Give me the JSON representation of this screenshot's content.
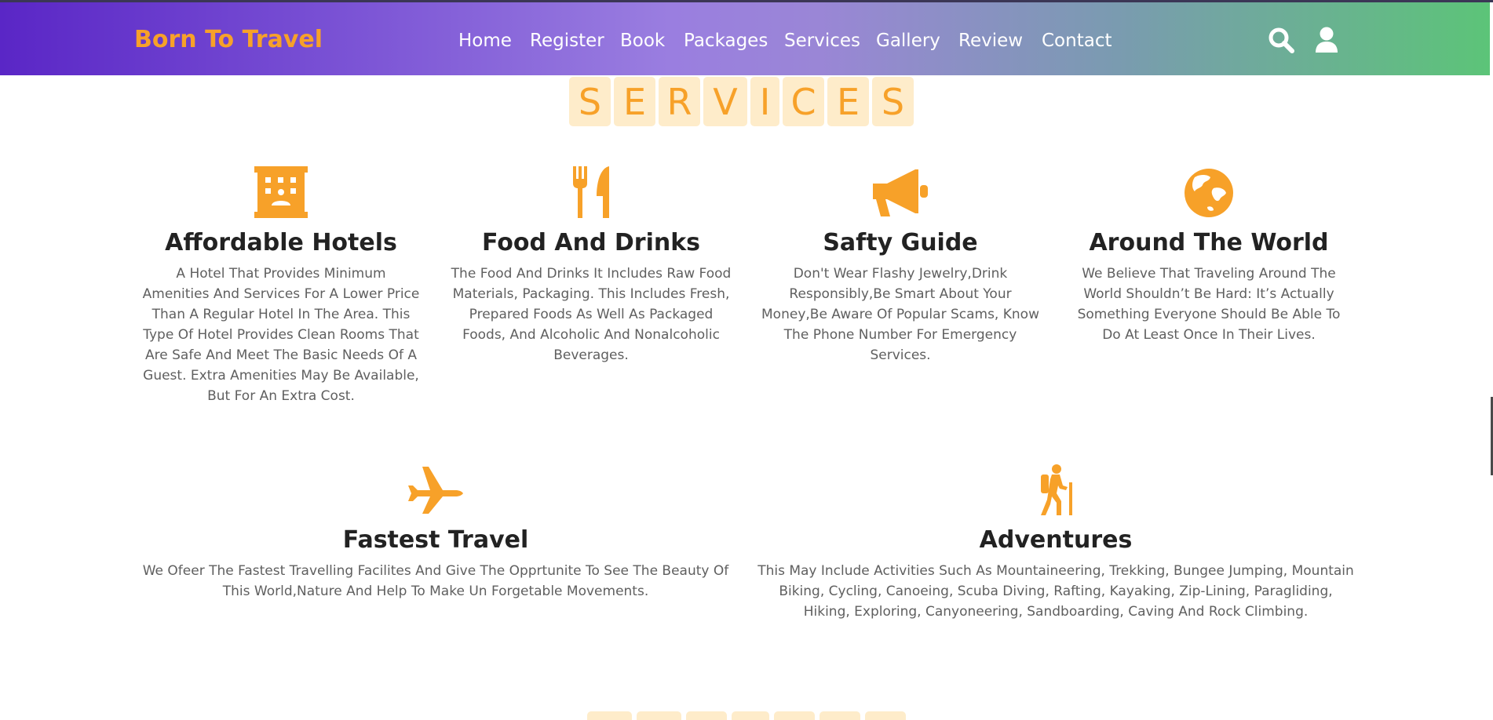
{
  "header": {
    "logo": "Born To Travel",
    "nav": [
      "Home",
      "Register",
      "Book",
      "Packages",
      "Services",
      "Gallery",
      "Review",
      "Contact"
    ],
    "icons": [
      "search-icon",
      "user-icon"
    ]
  },
  "section": {
    "title_letters": [
      "S",
      "E",
      "R",
      "V",
      "I",
      "C",
      "E",
      "S"
    ]
  },
  "services": [
    {
      "icon": "hotel-icon",
      "title": "Affordable Hotels",
      "text": "A Hotel That Provides Minimum Amenities And Services For A Lower Price Than A Regular Hotel In The Area. This Type Of Hotel Provides Clean Rooms That Are Safe And Meet The Basic Needs Of A Guest. Extra Amenities May Be Available, But For An Extra Cost."
    },
    {
      "icon": "utensils-icon",
      "title": "Food And Drinks",
      "text": "The Food And Drinks It Includes Raw Food Materials, Packaging. This Includes Fresh, Prepared Foods As Well As Packaged Foods, And Alcoholic And Nonalcoholic Beverages."
    },
    {
      "icon": "bullhorn-icon",
      "title": "Safty Guide",
      "text": "Don't Wear Flashy Jewelry,Drink Responsibly,Be Smart About Your Money,Be Aware Of Popular Scams, Know The Phone Number For Emergency Services."
    },
    {
      "icon": "globe-icon",
      "title": "Around The World",
      "text": "We Believe That Traveling Around The World Shouldn’t Be Hard: It’s Actually Something Everyone Should Be Able To Do At Least Once In Their Lives."
    },
    {
      "icon": "plane-icon",
      "title": "Fastest Travel",
      "text": "We Ofeer The Fastest Travelling Facilites And Give The Opprtunite To See The Beauty Of This World,Nature And Help To Make Un Forgetable Movements."
    },
    {
      "icon": "hiking-icon",
      "title": "Adventures",
      "text": "This May Include Activities Such As Mountaineering, Trekking, Bungee Jumping, Mountain Biking, Cycling, Canoeing, Scuba Diving, Rafting, Kayaking, Zip-Lining, Paragliding, Hiking, Exploring, Canyoneering, Sandboarding, Caving And Rock Climbing."
    }
  ],
  "colors": {
    "accent": "#f7a129",
    "tile_bg": "#feecca",
    "heading": "#222222",
    "body_text": "#5f5f5f"
  }
}
